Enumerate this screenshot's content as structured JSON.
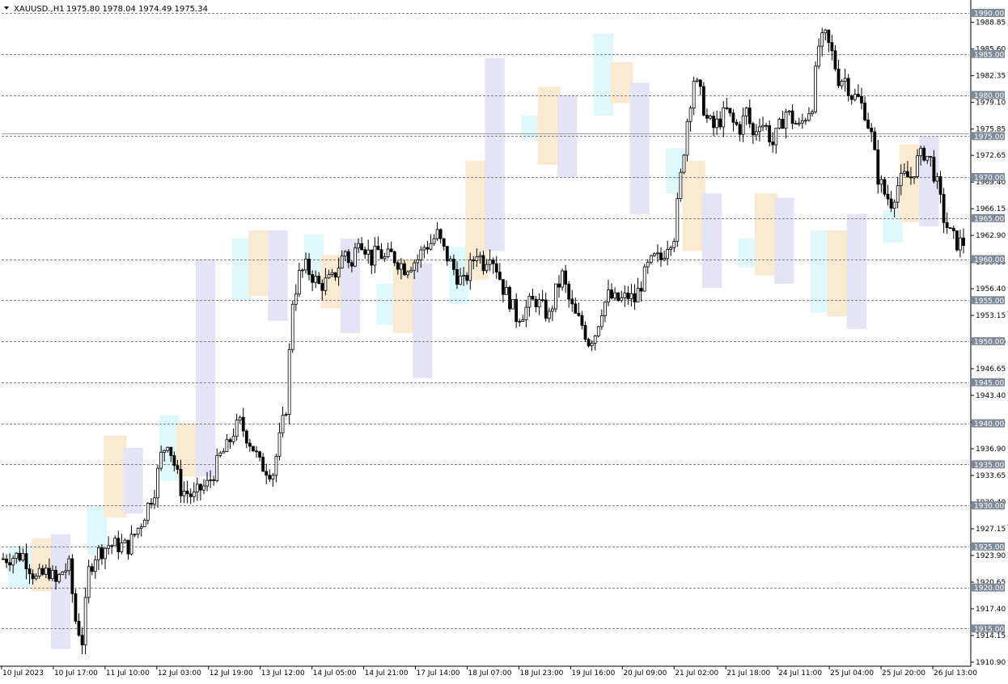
{
  "header": {
    "symbol": "XAUUSD.,H1",
    "ohlc": "1975.80 1978.04 1974.49 1975.34"
  },
  "colors": {
    "bull_body": "#ffffff",
    "bear_body": "#000000",
    "wick": "#000000",
    "grid_line": "#808080",
    "price_tag_bg": "#7f8a99",
    "zone_cyan": "#dff8fb",
    "zone_orange": "#fbead2",
    "zone_lavender": "#e4e4f6"
  },
  "chart_data": {
    "type": "candlestick",
    "title": "XAUUSD.,H1",
    "ylim": [
      1910.9,
      1991.5
    ],
    "y_ticks": [
      "1988.85",
      "1985.60",
      "1982.35",
      "1979.10",
      "1975.85",
      "1972.65",
      "1969.40",
      "1966.15",
      "1962.90",
      "1959.65",
      "1956.40",
      "1953.15",
      "1949.90",
      "1946.65",
      "1943.40",
      "1940.15",
      "1936.90",
      "1933.65",
      "1930.40",
      "1927.15",
      "1923.90",
      "1920.65",
      "1917.40",
      "1914.15",
      "1910.90"
    ],
    "levels": [
      "1990.00",
      "1985.00",
      "1980.00",
      "1975.00",
      "1970.00",
      "1965.00",
      "1960.00",
      "1955.00",
      "1950.00",
      "1945.00",
      "1940.00",
      "1935.00",
      "1930.00",
      "1925.00",
      "1920.00",
      "1915.00"
    ],
    "current_price": 1975.34,
    "x_labels": [
      "10 Jul 2023",
      "10 Jul 17:00",
      "11 Jul 10:00",
      "12 Jul 03:00",
      "12 Jul 19:00",
      "13 Jul 12:00",
      "14 Jul 05:00",
      "14 Jul 21:00",
      "17 Jul 14:00",
      "18 Jul 07:00",
      "18 Jul 23:00",
      "19 Jul 16:00",
      "20 Jul 09:00",
      "21 Jul 02:00",
      "21 Jul 18:00",
      "24 Jul 11:00",
      "25 Jul 04:00",
      "25 Jul 20:00",
      "26 Jul 13:00"
    ],
    "candles_count": 293,
    "price_path": [
      [
        0,
        1923.5
      ],
      [
        6,
        1924
      ],
      [
        10,
        1921
      ],
      [
        14,
        1922
      ],
      [
        16,
        1920.5
      ],
      [
        18,
        1922
      ],
      [
        20,
        1922.5
      ],
      [
        22,
        1916
      ],
      [
        24,
        1913.5
      ],
      [
        26,
        1922
      ],
      [
        28,
        1924
      ],
      [
        32,
        1925.2
      ],
      [
        38,
        1925
      ],
      [
        42,
        1928
      ],
      [
        44,
        1930
      ],
      [
        46,
        1932
      ],
      [
        48,
        1936
      ],
      [
        50,
        1938
      ],
      [
        52,
        1935
      ],
      [
        54,
        1932
      ],
      [
        56,
        1931.5
      ],
      [
        58,
        1931
      ],
      [
        60,
        1932
      ],
      [
        62,
        1932.5
      ],
      [
        64,
        1934
      ],
      [
        66,
        1936
      ],
      [
        68,
        1937
      ],
      [
        70,
        1939
      ],
      [
        72,
        1940
      ],
      [
        76,
        1937
      ],
      [
        78,
        1935
      ],
      [
        82,
        1934
      ],
      [
        86,
        1942
      ],
      [
        88,
        1955
      ],
      [
        90,
        1958
      ],
      [
        92,
        1959
      ],
      [
        94,
        1958
      ],
      [
        96,
        1956.8
      ],
      [
        100,
        1957.5
      ],
      [
        104,
        1961
      ],
      [
        106,
        1959
      ],
      [
        108,
        1963
      ],
      [
        112,
        1960
      ],
      [
        114,
        1961
      ],
      [
        116,
        1960
      ],
      [
        118,
        1960.5
      ],
      [
        122,
        1959
      ],
      [
        126,
        1960
      ],
      [
        128,
        1961.5
      ],
      [
        130,
        1962
      ],
      [
        132,
        1963
      ],
      [
        134,
        1961
      ],
      [
        136,
        1959.5
      ],
      [
        138,
        1958
      ],
      [
        140,
        1957
      ],
      [
        142,
        1959
      ],
      [
        144,
        1961
      ],
      [
        146,
        1959.5
      ],
      [
        148,
        1961
      ],
      [
        150,
        1959
      ],
      [
        152,
        1956.5
      ],
      [
        154,
        1955
      ],
      [
        156,
        1953
      ],
      [
        158,
        1953.5
      ],
      [
        160,
        1954.5
      ],
      [
        162,
        1955
      ],
      [
        164,
        1954
      ],
      [
        166,
        1953
      ],
      [
        168,
        1956
      ],
      [
        170,
        1958
      ],
      [
        172,
        1955
      ],
      [
        174,
        1953
      ],
      [
        176,
        1952
      ],
      [
        178,
        1950
      ],
      [
        180,
        1951
      ],
      [
        182,
        1954
      ],
      [
        184,
        1955.5
      ],
      [
        186,
        1955
      ],
      [
        188,
        1955
      ],
      [
        190,
        1955.5
      ],
      [
        192,
        1955
      ],
      [
        194,
        1957
      ],
      [
        196,
        1959
      ],
      [
        198,
        1960
      ],
      [
        200,
        1960
      ],
      [
        202,
        1962
      ],
      [
        204,
        1963
      ],
      [
        206,
        1970
      ],
      [
        208,
        1977
      ],
      [
        210,
        1982
      ],
      [
        212,
        1980
      ],
      [
        214,
        1977
      ],
      [
        216,
        1976
      ],
      [
        218,
        1977
      ],
      [
        220,
        1978
      ],
      [
        222,
        1976.5
      ],
      [
        224,
        1976
      ],
      [
        226,
        1978
      ],
      [
        228,
        1975
      ],
      [
        230,
        1977
      ],
      [
        232,
        1976
      ],
      [
        234,
        1974
      ],
      [
        236,
        1976
      ],
      [
        238,
        1978
      ],
      [
        240,
        1977
      ],
      [
        242,
        1976
      ],
      [
        244,
        1977.5
      ],
      [
        246,
        1979
      ],
      [
        248,
        1986
      ],
      [
        250,
        1987
      ],
      [
        252,
        1985
      ],
      [
        254,
        1982
      ],
      [
        256,
        1982
      ],
      [
        258,
        1980
      ],
      [
        260,
        1979.5
      ],
      [
        262,
        1978
      ],
      [
        264,
        1975
      ],
      [
        266,
        1970
      ],
      [
        268,
        1968
      ],
      [
        270,
        1967
      ],
      [
        272,
        1969
      ],
      [
        274,
        1970
      ],
      [
        276,
        1970
      ],
      [
        278,
        1972
      ],
      [
        280,
        1973
      ],
      [
        282,
        1972
      ],
      [
        284,
        1969
      ],
      [
        286,
        1965
      ],
      [
        288,
        1963
      ],
      [
        290,
        1962
      ]
    ],
    "zones": [
      {
        "from": 2,
        "to": 8,
        "kind": "cyan",
        "lo": 1920,
        "hi": 1925
      },
      {
        "from": 9,
        "to": 14,
        "kind": "orange",
        "lo": 1919.5,
        "hi": 1926
      },
      {
        "from": 15,
        "to": 20,
        "kind": "lavender",
        "lo": 1912.5,
        "hi": 1926.5
      },
      {
        "from": 26,
        "to": 31,
        "kind": "cyan",
        "lo": 1924,
        "hi": 1930
      },
      {
        "from": 31,
        "to": 37,
        "kind": "orange",
        "lo": 1928.5,
        "hi": 1938.5
      },
      {
        "from": 37,
        "to": 42,
        "kind": "lavender",
        "lo": 1929,
        "hi": 1937
      },
      {
        "from": 48,
        "to": 53,
        "kind": "cyan",
        "lo": 1933,
        "hi": 1941
      },
      {
        "from": 53,
        "to": 59,
        "kind": "orange",
        "lo": 1933.5,
        "hi": 1940
      },
      {
        "from": 59,
        "to": 64,
        "kind": "lavender",
        "lo": 1933.5,
        "hi": 1960
      },
      {
        "from": 70,
        "to": 75,
        "kind": "cyan",
        "lo": 1955,
        "hi": 1962.5
      },
      {
        "from": 75,
        "to": 81,
        "kind": "orange",
        "lo": 1955.5,
        "hi": 1963.5
      },
      {
        "from": 81,
        "to": 86,
        "kind": "lavender",
        "lo": 1952.5,
        "hi": 1963.5
      },
      {
        "from": 92,
        "to": 97,
        "kind": "cyan",
        "lo": 1958,
        "hi": 1963
      },
      {
        "from": 97,
        "to": 103,
        "kind": "orange",
        "lo": 1954,
        "hi": 1960.5
      },
      {
        "from": 103,
        "to": 108,
        "kind": "lavender",
        "lo": 1951,
        "hi": 1962.5
      },
      {
        "from": 114,
        "to": 119,
        "kind": "cyan",
        "lo": 1952,
        "hi": 1957
      },
      {
        "from": 119,
        "to": 125,
        "kind": "orange",
        "lo": 1951,
        "hi": 1960
      },
      {
        "from": 125,
        "to": 130,
        "kind": "lavender",
        "lo": 1945.5,
        "hi": 1959.5
      },
      {
        "from": 136,
        "to": 141,
        "kind": "cyan",
        "lo": 1954.5,
        "hi": 1961.5
      },
      {
        "from": 141,
        "to": 147,
        "kind": "orange",
        "lo": 1957.5,
        "hi": 1972
      },
      {
        "from": 147,
        "to": 152,
        "kind": "lavender",
        "lo": 1961,
        "hi": 1984.5
      },
      {
        "from": 158,
        "to": 163,
        "kind": "cyan",
        "lo": 1974.5,
        "hi": 1977.5
      },
      {
        "from": 163,
        "to": 169,
        "kind": "orange",
        "lo": 1971.5,
        "hi": 1981
      },
      {
        "from": 169,
        "to": 174,
        "kind": "lavender",
        "lo": 1970,
        "hi": 1980
      },
      {
        "from": 180,
        "to": 185,
        "kind": "cyan",
        "lo": 1977.5,
        "hi": 1987.5
      },
      {
        "from": 185,
        "to": 191,
        "kind": "orange",
        "lo": 1979,
        "hi": 1984
      },
      {
        "from": 191,
        "to": 196,
        "kind": "lavender",
        "lo": 1965.5,
        "hi": 1981.5
      },
      {
        "from": 202,
        "to": 207,
        "kind": "cyan",
        "lo": 1968,
        "hi": 1973.5
      },
      {
        "from": 207,
        "to": 213,
        "kind": "orange",
        "lo": 1961,
        "hi": 1972
      },
      {
        "from": 213,
        "to": 218,
        "kind": "lavender",
        "lo": 1956.5,
        "hi": 1968
      },
      {
        "from": 224,
        "to": 229,
        "kind": "cyan",
        "lo": 1959,
        "hi": 1962.5
      },
      {
        "from": 229,
        "to": 235,
        "kind": "orange",
        "lo": 1958,
        "hi": 1968
      },
      {
        "from": 235,
        "to": 240,
        "kind": "lavender",
        "lo": 1957,
        "hi": 1967.5
      },
      {
        "from": 246,
        "to": 251,
        "kind": "cyan",
        "lo": 1953.5,
        "hi": 1963.5
      },
      {
        "from": 251,
        "to": 257,
        "kind": "orange",
        "lo": 1953,
        "hi": 1963.5
      },
      {
        "from": 257,
        "to": 262,
        "kind": "lavender",
        "lo": 1951.5,
        "hi": 1965.5
      },
      {
        "from": 268,
        "to": 273,
        "kind": "cyan",
        "lo": 1962,
        "hi": 1966
      },
      {
        "from": 273,
        "to": 279,
        "kind": "orange",
        "lo": 1964.5,
        "hi": 1974
      },
      {
        "from": 279,
        "to": 284,
        "kind": "lavender",
        "lo": 1964,
        "hi": 1975
      }
    ]
  }
}
